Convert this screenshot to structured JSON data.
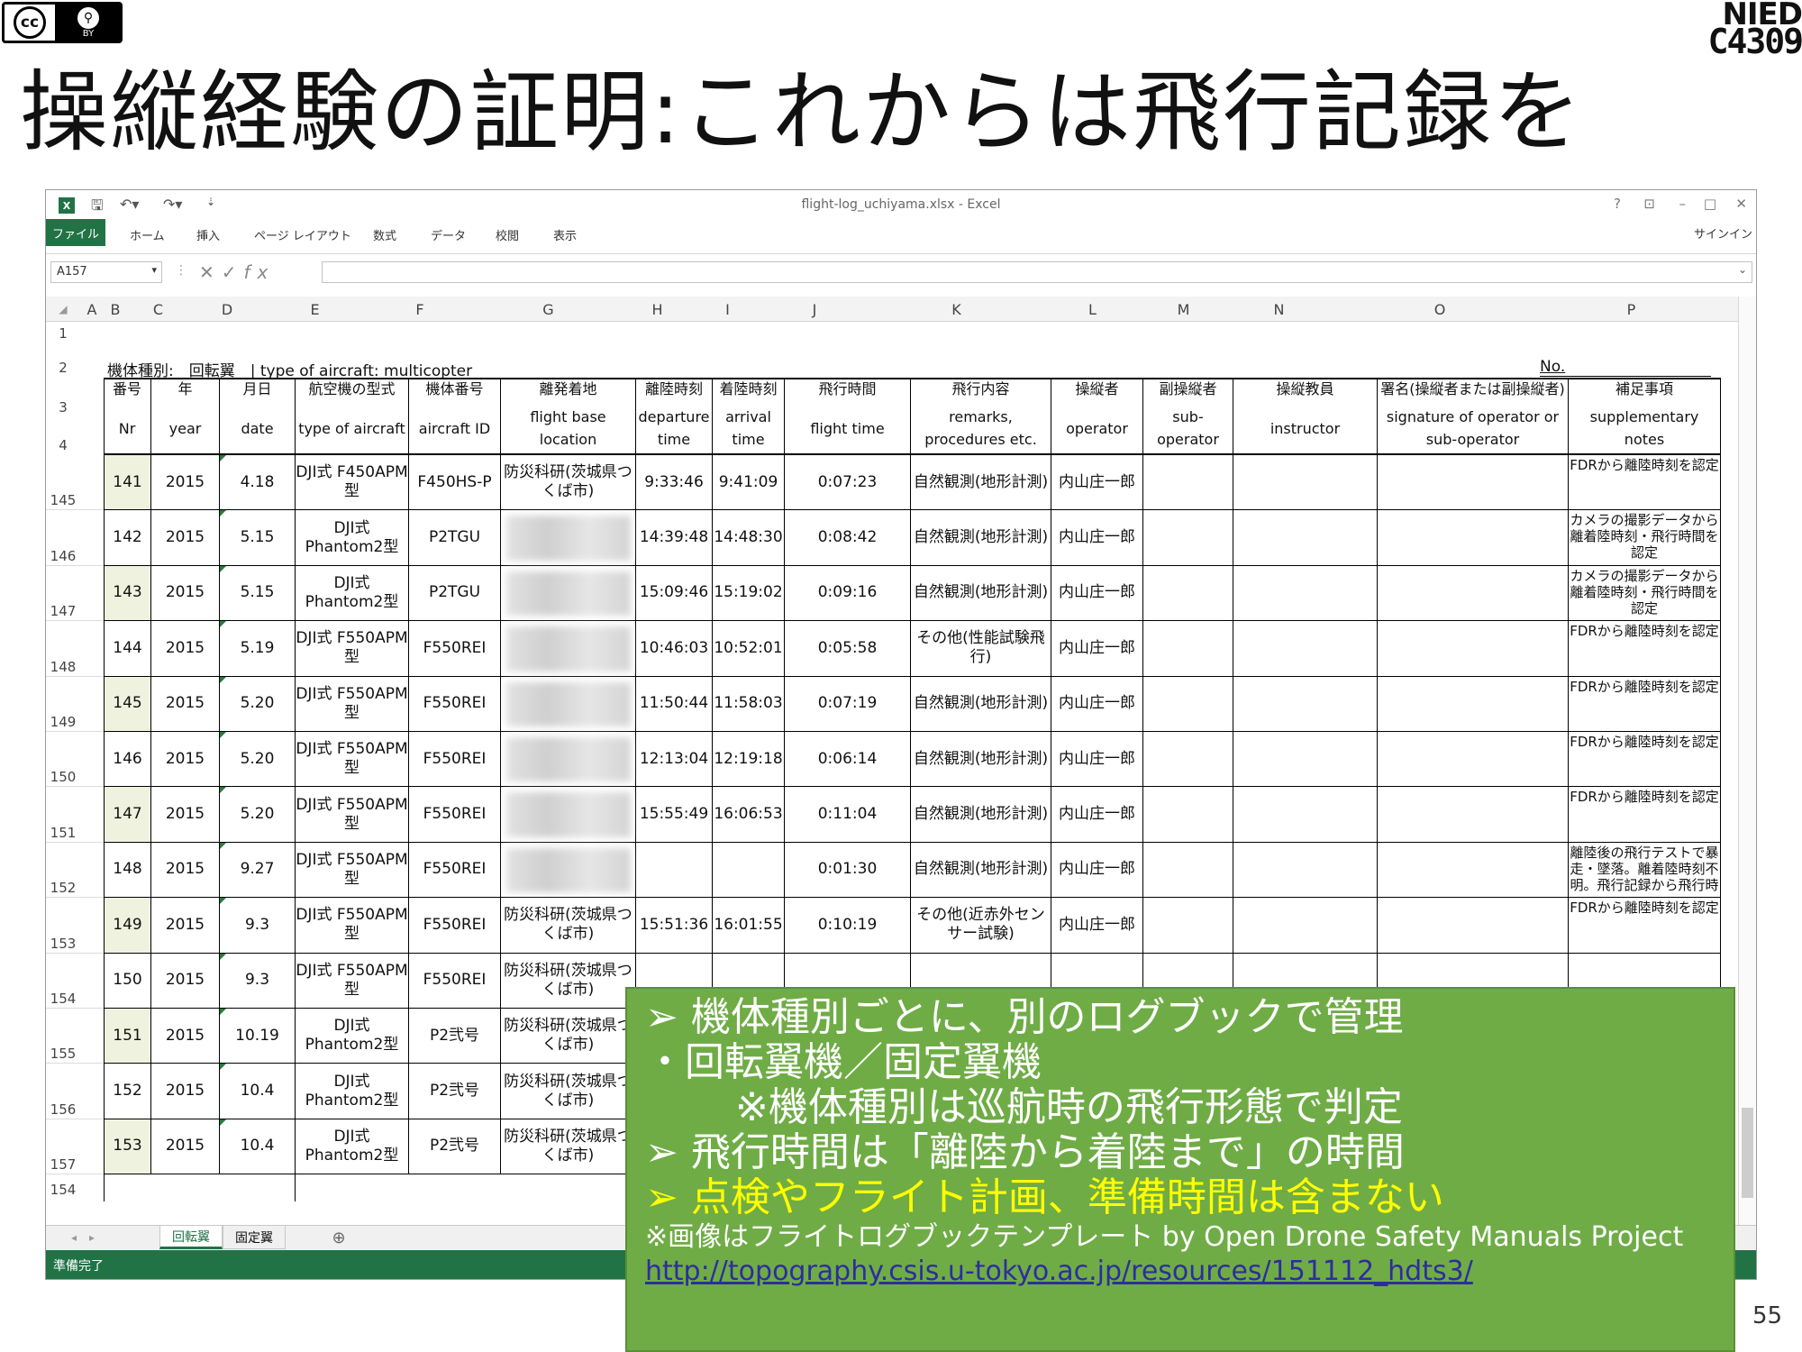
{
  "slide": {
    "title": "操縦経験の証明:これからは飛行記録を",
    "page_number": "55",
    "license": {
      "cc": "cc",
      "by": "BY"
    },
    "logo": {
      "line1": "NIED",
      "line2": "C4309"
    }
  },
  "excel": {
    "window_title": "flight-log_uchiyama.xlsx - Excel",
    "window_controls": [
      "?",
      "⊡",
      "–",
      "□",
      "✕"
    ],
    "ribbon_tabs": [
      "ファイル",
      "ホーム",
      "挿入",
      "ページ レイアウト",
      "数式",
      "データ",
      "校閲",
      "表示"
    ],
    "signin": "サインイン",
    "name_box": "A157",
    "columns": [
      "A",
      "B",
      "C",
      "D",
      "E",
      "F",
      "G",
      "H",
      "I",
      "J",
      "K",
      "L",
      "M",
      "N",
      "O",
      "P"
    ],
    "row_numbers": {
      "r1": "1",
      "r2": "2",
      "r3": "3",
      "r4": "4",
      "r154": "154"
    },
    "row2": {
      "left": "機体種別:　回転翼　| type of aircraft: multicopter",
      "right": "No."
    },
    "header_jp": [
      "番号",
      "年",
      "月日",
      "航空機の型式",
      "機体番号",
      "離発着地",
      "離陸時刻",
      "着陸時刻",
      "飛行時間",
      "飛行内容",
      "操縦者",
      "副操縦者",
      "操縦教員",
      "署名(操縦者または副操縦者)",
      "補足事項"
    ],
    "header_en": [
      "Nr",
      "year",
      "date",
      "type of aircraft",
      "aircraft ID",
      "flight base location",
      "departure time",
      "arrival time",
      "flight time",
      "remarks, procedures etc.",
      "operator",
      "sub-operator",
      "instructor",
      "signature of operator or sub-operator",
      "supplementary notes"
    ],
    "rows": [
      {
        "row": "145",
        "nr": "141",
        "year": "2015",
        "date": "4.18",
        "type": "DJI式 F450APM型",
        "id": "F450HS-P",
        "loc": "防災科研(茨城県つくば市)",
        "dep": "9:33:46",
        "arr": "9:41:09",
        "ft": "0:07:23",
        "rem": "自然観測(地形計測)",
        "op": "内山庄一郎",
        "note": "FDRから離陸時刻を認定"
      },
      {
        "row": "146",
        "nr": "142",
        "year": "2015",
        "date": "5.15",
        "type": "DJI式 Phantom2型",
        "id": "P2TGU",
        "loc": "",
        "dep": "14:39:48",
        "arr": "14:48:30",
        "ft": "0:08:42",
        "rem": "自然観測(地形計測)",
        "op": "内山庄一郎",
        "note": "カメラの撮影データから離着陸時刻・飛行時間を認定"
      },
      {
        "row": "147",
        "nr": "143",
        "year": "2015",
        "date": "5.15",
        "type": "DJI式 Phantom2型",
        "id": "P2TGU",
        "loc": "",
        "dep": "15:09:46",
        "arr": "15:19:02",
        "ft": "0:09:16",
        "rem": "自然観測(地形計測)",
        "op": "内山庄一郎",
        "note": "カメラの撮影データから離着陸時刻・飛行時間を認定"
      },
      {
        "row": "148",
        "nr": "144",
        "year": "2015",
        "date": "5.19",
        "type": "DJI式 F550APM型",
        "id": "F550REI",
        "loc": "",
        "dep": "10:46:03",
        "arr": "10:52:01",
        "ft": "0:05:58",
        "rem": "その他(性能試験飛行)",
        "op": "内山庄一郎",
        "note": "FDRから離陸時刻を認定"
      },
      {
        "row": "149",
        "nr": "145",
        "year": "2015",
        "date": "5.20",
        "type": "DJI式 F550APM型",
        "id": "F550REI",
        "loc": "",
        "dep": "11:50:44",
        "arr": "11:58:03",
        "ft": "0:07:19",
        "rem": "自然観測(地形計測)",
        "op": "内山庄一郎",
        "note": "FDRから離陸時刻を認定"
      },
      {
        "row": "150",
        "nr": "146",
        "year": "2015",
        "date": "5.20",
        "type": "DJI式 F550APM型",
        "id": "F550REI",
        "loc": "",
        "dep": "12:13:04",
        "arr": "12:19:18",
        "ft": "0:06:14",
        "rem": "自然観測(地形計測)",
        "op": "内山庄一郎",
        "note": "FDRから離陸時刻を認定"
      },
      {
        "row": "151",
        "nr": "147",
        "year": "2015",
        "date": "5.20",
        "type": "DJI式 F550APM型",
        "id": "F550REI",
        "loc": "",
        "dep": "15:55:49",
        "arr": "16:06:53",
        "ft": "0:11:04",
        "rem": "自然観測(地形計測)",
        "op": "内山庄一郎",
        "note": "FDRから離陸時刻を認定"
      },
      {
        "row": "152",
        "nr": "148",
        "year": "2015",
        "date": "9.27",
        "type": "DJI式 F550APM型",
        "id": "F550REI",
        "loc": "",
        "dep": "",
        "arr": "",
        "ft": "0:01:30",
        "rem": "自然観測(地形計測)",
        "op": "内山庄一郎",
        "note": "離陸後の飛行テストで暴走・墜落。離着陸時刻不明。飛行記録から飛行時"
      },
      {
        "row": "153",
        "nr": "149",
        "year": "2015",
        "date": "9.3",
        "type": "DJI式 F550APM型",
        "id": "F550REI",
        "loc": "防災科研(茨城県つくば市)",
        "dep": "15:51:36",
        "arr": "16:01:55",
        "ft": "0:10:19",
        "rem": "その他(近赤外センサー試験)",
        "op": "内山庄一郎",
        "note": "FDRから離陸時刻を認定"
      },
      {
        "row": "154",
        "nr": "150",
        "year": "2015",
        "date": "9.3",
        "type": "DJI式 F550APM型",
        "id": "F550REI",
        "loc": "防災科研(茨城県つくば市)",
        "dep": "",
        "arr": "",
        "ft": "",
        "rem": "",
        "op": "",
        "note": ""
      },
      {
        "row": "155",
        "nr": "151",
        "year": "2015",
        "date": "10.19",
        "type": "DJI式 Phantom2型",
        "id": "P2弐号",
        "loc": "防災科研(茨城県つくば市)",
        "dep": "",
        "arr": "",
        "ft": "",
        "rem": "",
        "op": "",
        "note": ""
      },
      {
        "row": "156",
        "nr": "152",
        "year": "2015",
        "date": "10.4",
        "type": "DJI式 Phantom2型",
        "id": "P2弐号",
        "loc": "防災科研(茨城県つくば市)",
        "dep": "",
        "arr": "",
        "ft": "",
        "rem": "",
        "op": "",
        "note": ""
      },
      {
        "row": "157",
        "nr": "153",
        "year": "2015",
        "date": "10.4",
        "type": "DJI式 Phantom2型",
        "id": "P2弐号",
        "loc": "防災科研(茨城県つくば市)",
        "dep": "",
        "arr": "",
        "ft": "",
        "rem": "",
        "op": "",
        "note": ""
      }
    ],
    "sheet_tabs": [
      "回転翼",
      "固定翼"
    ],
    "add_sheet": "⊕",
    "status": "準備完了"
  },
  "note": {
    "l1": "➢  機体種別ごとに、別のログブックで管理",
    "l2": "・回転翼機／固定翼機",
    "l3": "※機体種別は巡航時の飛行形態で判定",
    "l4": "➢  飛行時間は「離陸から着陸まで」の時間",
    "l5": "➢  点検やフライト計画、準備時間は含まない",
    "l6": "※画像はフライトログブックテンプレート by Open Drone Safety Manuals Project",
    "l7": "http://topography.csis.u-tokyo.ac.jp/resources/151112_hdts3/"
  },
  "colors": {
    "excel_green": "#217346",
    "note_green": "#6fac46",
    "highlight_yellow": "#ffff00",
    "nr_fill": "#eef2df"
  }
}
